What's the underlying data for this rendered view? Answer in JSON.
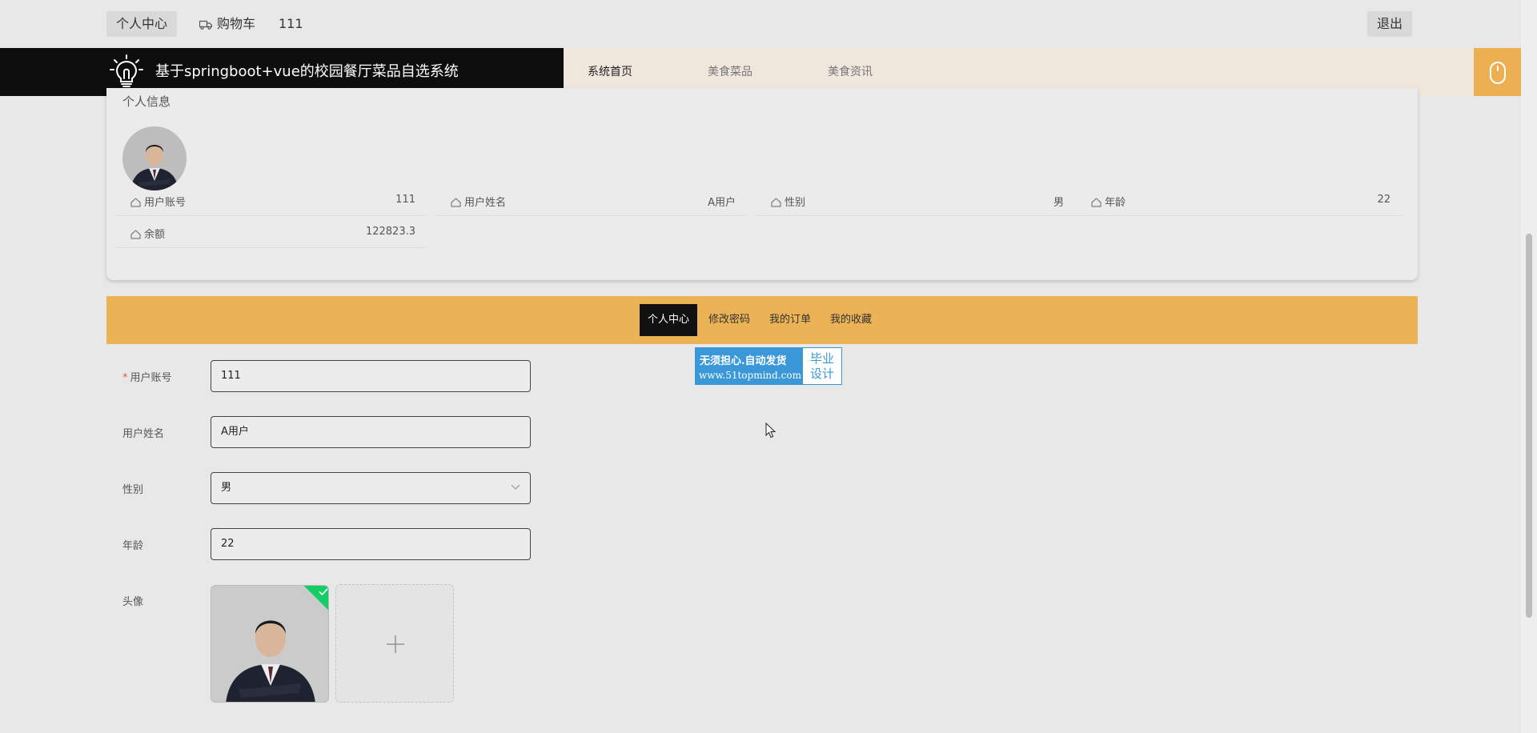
{
  "topbar": {
    "personal_center": "个人中心",
    "cart": "购物车",
    "username": "111",
    "logout": "退出",
    "cart_icon": "truck-icon"
  },
  "header": {
    "logo_icon": "lightbulb-icon",
    "site_title": "基于springboot+vue的校园餐厅菜品自选系统",
    "nav": [
      "系统首页",
      "美食菜品",
      "美食资讯"
    ],
    "mouse_icon": "mouse-icon",
    "accent_color": "#ecb053"
  },
  "profile": {
    "heading": "个人信息",
    "avatar_icon": "user-avatar",
    "fields": [
      {
        "label": "用户账号",
        "value": "111"
      },
      {
        "label": "用户姓名",
        "value": "A用户"
      },
      {
        "label": "性别",
        "value": "男"
      },
      {
        "label": "年龄",
        "value": "22"
      },
      {
        "label": "余额",
        "value": "122823.3"
      }
    ]
  },
  "tabs": {
    "items": [
      "个人中心",
      "修改密码",
      "我的订单",
      "我的收藏"
    ],
    "active_index": 0,
    "bar_color": "#ebb355"
  },
  "watermark": {
    "line1": "无须担心.自动发货",
    "line2": "www.51topmind.com",
    "box": [
      "毕业",
      "设计"
    ]
  },
  "form": {
    "account_label": "用户账号",
    "account_value": "111",
    "name_label": "用户姓名",
    "name_value": "A用户",
    "gender_label": "性别",
    "gender_value": "男",
    "age_label": "年龄",
    "age_value": "22",
    "avatar_label": "头像",
    "required_mark": "*"
  }
}
